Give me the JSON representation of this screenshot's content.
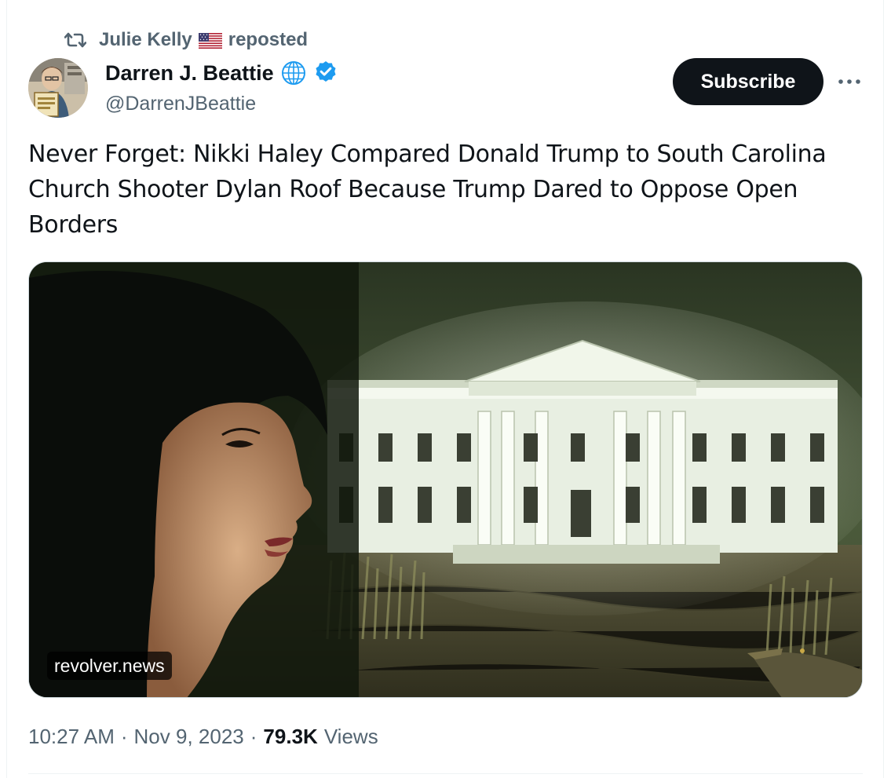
{
  "repost": {
    "icon": "repost-icon",
    "user": "Julie Kelly",
    "flag": "us-flag-icon",
    "label": "reposted"
  },
  "author": {
    "name": "Darren J. Beattie",
    "handle": "@DarrenJBeattie",
    "badges": [
      "globe-icon",
      "verified-badge-icon"
    ],
    "verified_color": "#1d9bf0"
  },
  "actions": {
    "subscribe_label": "Subscribe",
    "more_icon": "more-options-icon"
  },
  "tweet": {
    "text": "Never Forget: Nikki Haley Compared Donald Trump to South Carolina Church Shooter Dylan Roof Because Trump Dared to Oppose Open Borders"
  },
  "media": {
    "source_label": "revolver.news"
  },
  "meta": {
    "time": "10:27 AM",
    "separator": "·",
    "date": "Nov 9, 2023",
    "views_count": "79.3K",
    "views_label": "Views"
  },
  "colors": {
    "text_primary": "#0f1419",
    "text_secondary": "#536471",
    "button_bg": "#0f1419"
  }
}
